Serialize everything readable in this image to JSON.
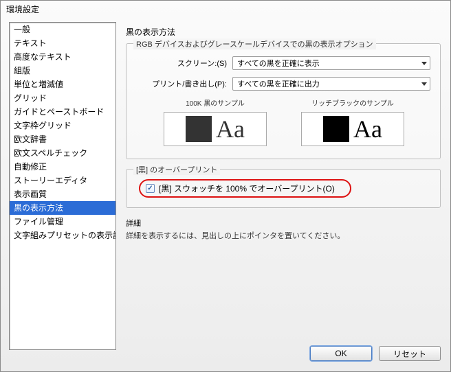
{
  "window": {
    "title": "環境設定"
  },
  "sidebar": {
    "items": [
      "一般",
      "テキスト",
      "高度なテキスト",
      "組版",
      "単位と増減値",
      "グリッド",
      "ガイドとペーストボード",
      "文字枠グリッド",
      "欧文辞書",
      "欧文スペルチェック",
      "自動修正",
      "ストーリーエディタ",
      "表示画質",
      "黒の表示方法",
      "ファイル管理",
      "文字組みプリセットの表示設定"
    ],
    "selected_index": 13
  },
  "main": {
    "title": "黒の表示方法",
    "rgb_group": {
      "legend": "RGB デバイスおよびグレースケールデバイスでの黒の表示オプション",
      "screen_label": "スクリーン:(S)",
      "screen_value": "すべての黒を正確に表示",
      "print_label": "プリント/書き出し(P):",
      "print_value": "すべての黒を正確に出力",
      "sample_100k_label": "100K 黒のサンプル",
      "sample_rich_label": "リッチブラックのサンプル",
      "sample_text": "Aa"
    },
    "overprint_group": {
      "legend": "[黒] のオーバープリント",
      "checkbox_label": "[黒] スウォッチを 100% でオーバープリント(O)",
      "checked": true
    },
    "details": {
      "title": "詳細",
      "text": "詳細を表示するには、見出しの上にポインタを置いてください。"
    }
  },
  "footer": {
    "ok": "OK",
    "reset": "リセット"
  }
}
